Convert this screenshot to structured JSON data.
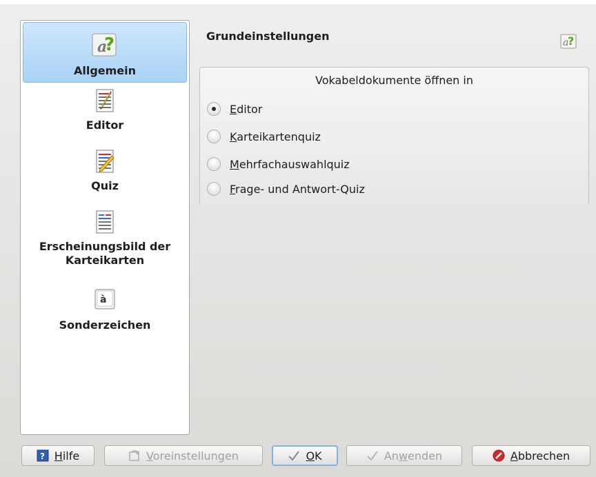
{
  "sidebar": {
    "items": [
      {
        "label": "Allgemein",
        "icon": "parley-icon",
        "selected": true
      },
      {
        "label": "Editor",
        "icon": "editor-icon"
      },
      {
        "label": "Quiz",
        "icon": "quiz-icon"
      },
      {
        "label": "Erscheinungsbild der Karteikarten",
        "icon": "flashcard-appearance-icon"
      },
      {
        "label": "Sonderzeichen",
        "icon": "special-characters-icon"
      }
    ]
  },
  "header": {
    "title": "Grundeinstellungen",
    "icon": "parley-icon"
  },
  "group": {
    "title": "Vokabeldokumente öffnen in",
    "options": [
      {
        "label": "Editor",
        "mnemonic": "E",
        "rest": "ditor",
        "checked": true
      },
      {
        "label": "Karteikartenquiz",
        "mnemonic": "K",
        "rest": "arteikartenquiz",
        "checked": false
      },
      {
        "label": "Mehrfachauswahlquiz",
        "mnemonic": "M",
        "rest": "ehrfachauswahlquiz",
        "checked": false
      },
      {
        "label": "Frage- und Antwort-Quiz",
        "mnemonic": "F",
        "rest": "rage- und Antwort-Quiz",
        "checked": false
      }
    ]
  },
  "buttons": {
    "help": {
      "pre": "",
      "mn": "H",
      "post": "ilfe",
      "icon": "help-icon"
    },
    "defaults": {
      "pre": "",
      "mn": "V",
      "post": "oreinstellungen",
      "icon": "restore-defaults-icon",
      "disabled": true
    },
    "ok": {
      "pre": "",
      "mn": "O",
      "post": "K",
      "icon": "checkmark-icon"
    },
    "apply": {
      "pre": "An",
      "mn": "w",
      "post": "enden",
      "icon": "checkmark-icon",
      "disabled": true
    },
    "cancel": {
      "pre": "",
      "mn": "A",
      "post": "bbrechen",
      "icon": "cancel-icon"
    }
  }
}
